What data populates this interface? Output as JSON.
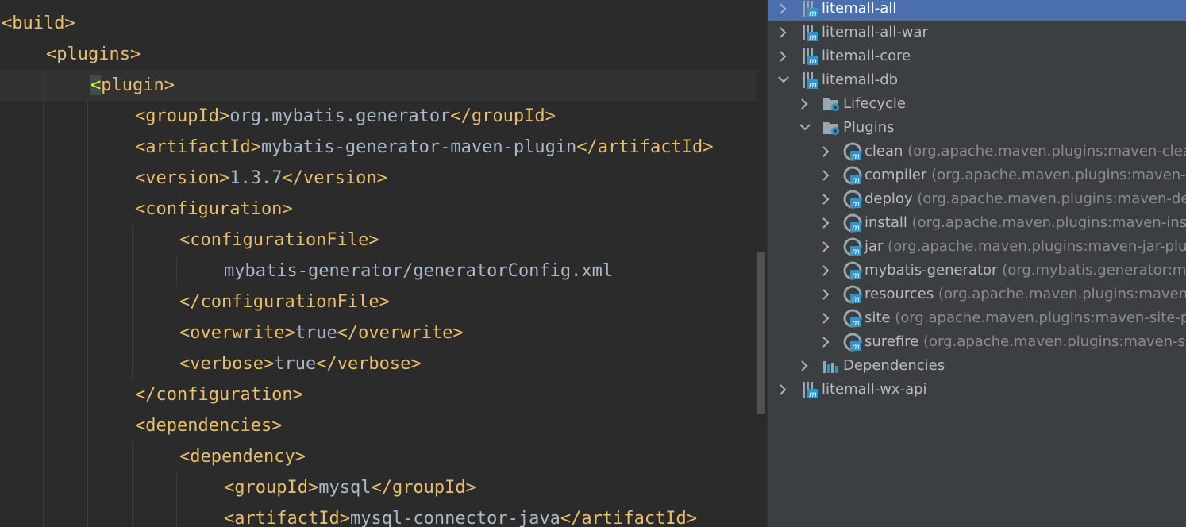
{
  "editor": {
    "lines": [
      {
        "indent": 0,
        "parts": [
          {
            "t": "tag",
            "v": "<build>"
          }
        ]
      },
      {
        "indent": 1,
        "parts": [
          {
            "t": "tag",
            "v": "<plugins>"
          }
        ]
      },
      {
        "indent": 2,
        "parts": [
          {
            "t": "hl",
            "v": "<"
          },
          {
            "t": "tag",
            "v": "plugin>"
          }
        ]
      },
      {
        "indent": 3,
        "parts": [
          {
            "t": "tag",
            "v": "<groupId>"
          },
          {
            "t": "txt",
            "v": "org.mybatis.generator"
          },
          {
            "t": "tag",
            "v": "</groupId>"
          }
        ]
      },
      {
        "indent": 3,
        "parts": [
          {
            "t": "tag",
            "v": "<artifactId>"
          },
          {
            "t": "txt",
            "v": "mybatis-generator-maven-plugin"
          },
          {
            "t": "tag",
            "v": "</artifactId>"
          }
        ]
      },
      {
        "indent": 3,
        "parts": [
          {
            "t": "tag",
            "v": "<version>"
          },
          {
            "t": "txt",
            "v": "1.3.7"
          },
          {
            "t": "tag",
            "v": "</version>"
          }
        ]
      },
      {
        "indent": 3,
        "parts": [
          {
            "t": "tag",
            "v": "<configuration>"
          }
        ]
      },
      {
        "indent": 4,
        "parts": [
          {
            "t": "tag",
            "v": "<configurationFile>"
          }
        ]
      },
      {
        "indent": 5,
        "parts": [
          {
            "t": "txt",
            "v": "mybatis-generator/generatorConfig.xml"
          }
        ]
      },
      {
        "indent": 4,
        "parts": [
          {
            "t": "tag",
            "v": "</configurationFile>"
          }
        ]
      },
      {
        "indent": 4,
        "parts": [
          {
            "t": "tag",
            "v": "<overwrite>"
          },
          {
            "t": "txt",
            "v": "true"
          },
          {
            "t": "tag",
            "v": "</overwrite>"
          }
        ]
      },
      {
        "indent": 4,
        "parts": [
          {
            "t": "tag",
            "v": "<verbose>"
          },
          {
            "t": "txt",
            "v": "true"
          },
          {
            "t": "tag",
            "v": "</verbose>"
          }
        ]
      },
      {
        "indent": 3,
        "parts": [
          {
            "t": "tag",
            "v": "</configuration>"
          }
        ]
      },
      {
        "indent": 3,
        "parts": [
          {
            "t": "tag",
            "v": "<dependencies>"
          }
        ]
      },
      {
        "indent": 4,
        "parts": [
          {
            "t": "tag",
            "v": "<dependency>"
          }
        ]
      },
      {
        "indent": 5,
        "parts": [
          {
            "t": "tag",
            "v": "<groupId>"
          },
          {
            "t": "txt",
            "v": "mysql"
          },
          {
            "t": "tag",
            "v": "</groupId>"
          }
        ]
      },
      {
        "indent": 5,
        "parts": [
          {
            "t": "tag",
            "v": "<artifactId>"
          },
          {
            "t": "txt",
            "v": "mysql-connector-java"
          },
          {
            "t": "tag",
            "v": "</artifactId>"
          }
        ]
      }
    ]
  },
  "maven_tree": {
    "items": [
      {
        "level": 0,
        "expanded": false,
        "icon": "maven-module-icon",
        "label": "litemall-all",
        "detail": "",
        "selected": true
      },
      {
        "level": 0,
        "expanded": false,
        "icon": "maven-module-icon",
        "label": "litemall-all-war",
        "detail": ""
      },
      {
        "level": 0,
        "expanded": false,
        "icon": "maven-module-icon",
        "label": "litemall-core",
        "detail": ""
      },
      {
        "level": 0,
        "expanded": true,
        "icon": "maven-module-icon",
        "label": "litemall-db",
        "detail": ""
      },
      {
        "level": 1,
        "expanded": false,
        "icon": "lifecycle-folder-icon",
        "label": "Lifecycle",
        "detail": ""
      },
      {
        "level": 1,
        "expanded": true,
        "icon": "plugins-folder-icon",
        "label": "Plugins",
        "detail": ""
      },
      {
        "level": 2,
        "expanded": false,
        "icon": "maven-plugin-icon",
        "label": "clean",
        "detail": "(org.apache.maven.plugins:maven-clean-"
      },
      {
        "level": 2,
        "expanded": false,
        "icon": "maven-plugin-icon",
        "label": "compiler",
        "detail": "(org.apache.maven.plugins:maven-co"
      },
      {
        "level": 2,
        "expanded": false,
        "icon": "maven-plugin-icon",
        "label": "deploy",
        "detail": "(org.apache.maven.plugins:maven-depl"
      },
      {
        "level": 2,
        "expanded": false,
        "icon": "maven-plugin-icon",
        "label": "install",
        "detail": "(org.apache.maven.plugins:maven-instal"
      },
      {
        "level": 2,
        "expanded": false,
        "icon": "maven-plugin-icon",
        "label": "jar",
        "detail": "(org.apache.maven.plugins:maven-jar-plugi"
      },
      {
        "level": 2,
        "expanded": false,
        "icon": "maven-plugin-icon",
        "label": "mybatis-generator",
        "detail": "(org.mybatis.generator:myb"
      },
      {
        "level": 2,
        "expanded": false,
        "icon": "maven-plugin-icon",
        "label": "resources",
        "detail": "(org.apache.maven.plugins:maven-re"
      },
      {
        "level": 2,
        "expanded": false,
        "icon": "maven-plugin-icon",
        "label": "site",
        "detail": "(org.apache.maven.plugins:maven-site-plu"
      },
      {
        "level": 2,
        "expanded": false,
        "icon": "maven-plugin-icon",
        "label": "surefire",
        "detail": "(org.apache.maven.plugins:maven-sure"
      },
      {
        "level": 1,
        "expanded": false,
        "icon": "dependencies-icon",
        "label": "Dependencies",
        "detail": ""
      },
      {
        "level": 0,
        "expanded": false,
        "icon": "maven-module-icon",
        "label": "litemall-wx-api",
        "detail": ""
      }
    ]
  },
  "colors": {
    "editor_bg": "#2b2b2b",
    "tag": "#e8bf6a",
    "text": "#a9b7c6",
    "tree_bg": "#3c3f41",
    "selection": "#4b6eaf"
  }
}
